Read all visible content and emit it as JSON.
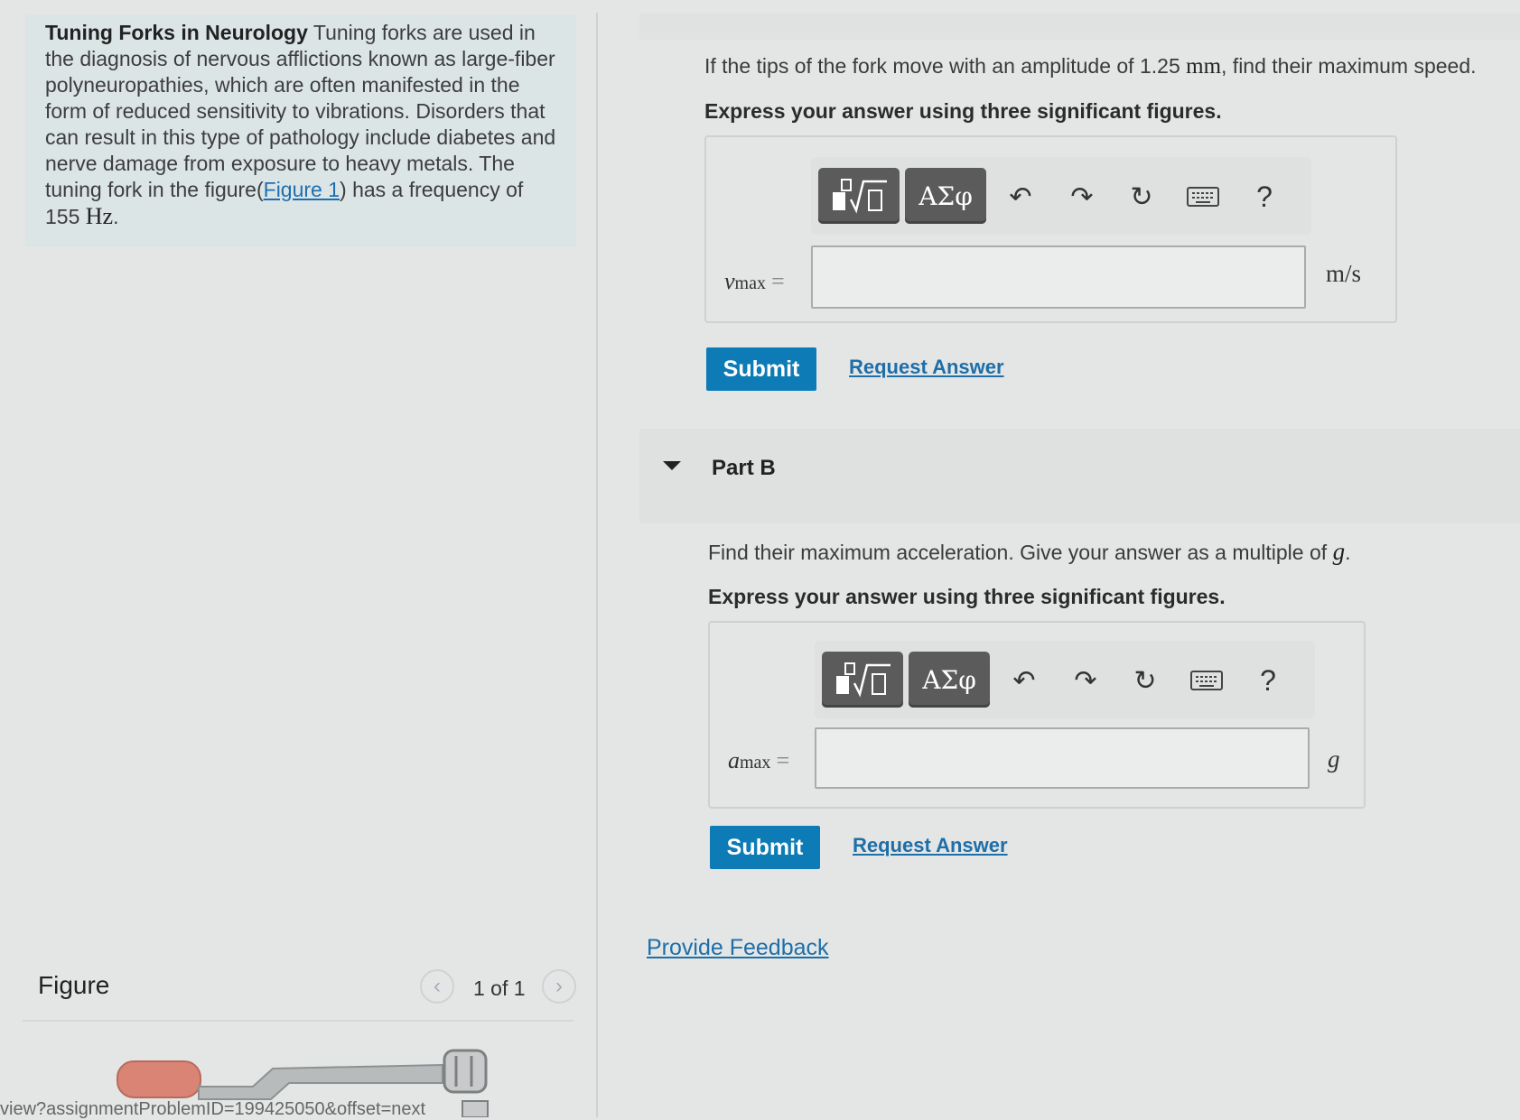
{
  "problem": {
    "title": "Tuning Forks in Neurology",
    "text_1": "Tuning forks are used in the diagnosis of nervous afflictions known as large-fiber polyneuropathies, which are often manifested in the form of reduced sensitivity to vibrations. Disorders that can result in this type of pathology include diabetes and nerve damage from exposure to heavy metals. The tuning fork in the figure(",
    "figure_link": "Figure 1",
    "text_2": ") has a frequency of 155",
    "unit": "Hz",
    "text_3": "."
  },
  "figure_panel": {
    "title": "Figure",
    "pager": "1 of 1",
    "prev_icon": "‹",
    "next_icon": "›",
    "url_text": "view?assignmentProblemID=199425050&offset=next"
  },
  "part_a": {
    "question_1": "If the tips of the fork move with an amplitude of 1.25",
    "question_unit": "mm",
    "question_2": ", find their maximum speed.",
    "instruction": "Express your answer using three significant figures.",
    "var": "v",
    "sub": "max",
    "eq": "=",
    "answer_value": "",
    "unit": "m/s",
    "submit": "Submit",
    "request": "Request Answer"
  },
  "part_b": {
    "header": "Part B",
    "question_1": "Find their maximum acceleration. Give your answer as a multiple of",
    "question_var": "g",
    "question_2": ".",
    "instruction": "Express your answer using three significant figures.",
    "var": "a",
    "sub": "max",
    "eq": "=",
    "answer_value": "",
    "unit": "g",
    "submit": "Submit",
    "request": "Request Answer"
  },
  "toolbar": {
    "greek_label": "ΑΣφ",
    "undo": "↶",
    "redo": "↷",
    "reset": "↻",
    "help": "?"
  },
  "feedback": "Provide Feedback"
}
